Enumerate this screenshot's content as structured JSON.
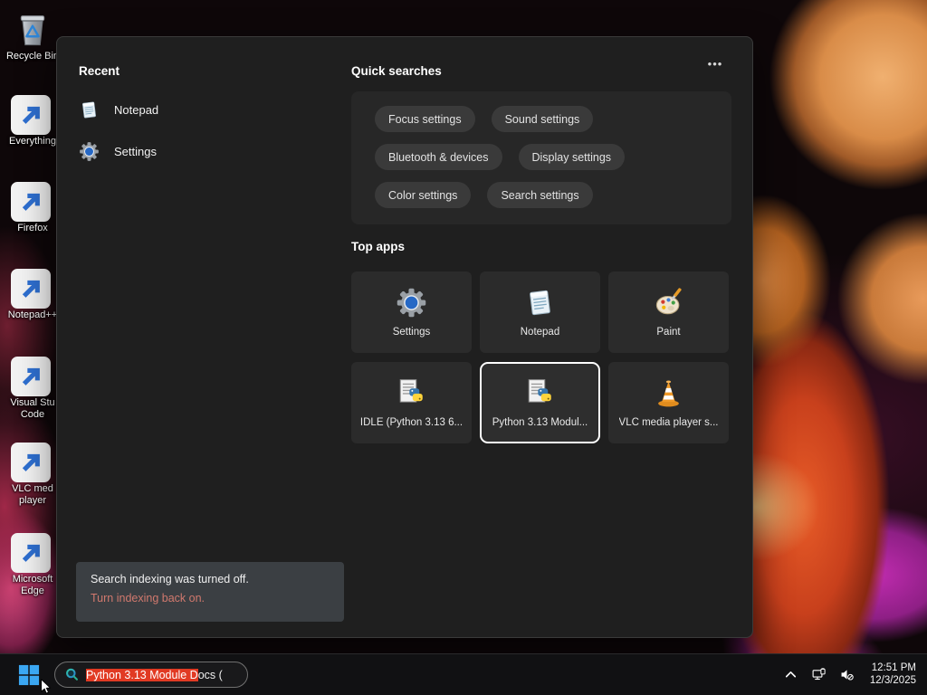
{
  "desktop": {
    "icons": [
      {
        "id": "recycle-bin",
        "label": "Recycle Bin"
      },
      {
        "id": "everything",
        "label": "Everything"
      },
      {
        "id": "firefox",
        "label": "Firefox"
      },
      {
        "id": "notepad-plus-plus",
        "label": "Notepad++"
      },
      {
        "id": "visual-studio-code",
        "label": "Visual Stu Code"
      },
      {
        "id": "vlc-media-player",
        "label": "VLC med player"
      },
      {
        "id": "microsoft-edge",
        "label": "Microsoft Edge"
      }
    ]
  },
  "panel": {
    "recent": {
      "title": "Recent",
      "items": [
        {
          "label": "Notepad",
          "icon": "notepad-icon"
        },
        {
          "label": "Settings",
          "icon": "settings-gear-icon"
        }
      ]
    },
    "quick": {
      "title": "Quick searches",
      "more": "•••",
      "pills": [
        "Focus settings",
        "Sound settings",
        "Bluetooth & devices",
        "Display settings",
        "Color settings",
        "Search settings"
      ]
    },
    "top_apps": {
      "title": "Top apps",
      "tiles": [
        {
          "label": "Settings",
          "icon": "settings-gear-icon",
          "selected": false
        },
        {
          "label": "Notepad",
          "icon": "notepad-icon",
          "selected": false
        },
        {
          "label": "Paint",
          "icon": "paint-palette-icon",
          "selected": false
        },
        {
          "label": "IDLE (Python 3.13 6...",
          "icon": "python-doc-icon",
          "selected": false
        },
        {
          "label": "Python 3.13 Modul...",
          "icon": "python-doc-icon",
          "selected": true
        },
        {
          "label": "VLC media player s...",
          "icon": "vlc-cone-icon",
          "selected": false
        }
      ]
    },
    "notice": {
      "message": "Search indexing was turned off.",
      "action": "Turn indexing back on."
    }
  },
  "taskbar": {
    "search": {
      "highlighted": "Python 3.13 Module D",
      "rest": "ocs (",
      "icon": "search-icon"
    },
    "tray_icons": [
      "chevron-up-icon",
      "network-icon",
      "volume-muted-icon"
    ],
    "clock": {
      "time": "12:51 PM",
      "date": "12/3/2025"
    }
  },
  "colors": {
    "panel_bg": "#1f1f1f",
    "card_bg": "#272727",
    "pill_bg": "#3a3a3a",
    "tile_bg": "#2b2b2b",
    "selection_red": "#e13a23",
    "notice_link_red": "#d1796e",
    "accent_blue": "#3ba7f2"
  }
}
